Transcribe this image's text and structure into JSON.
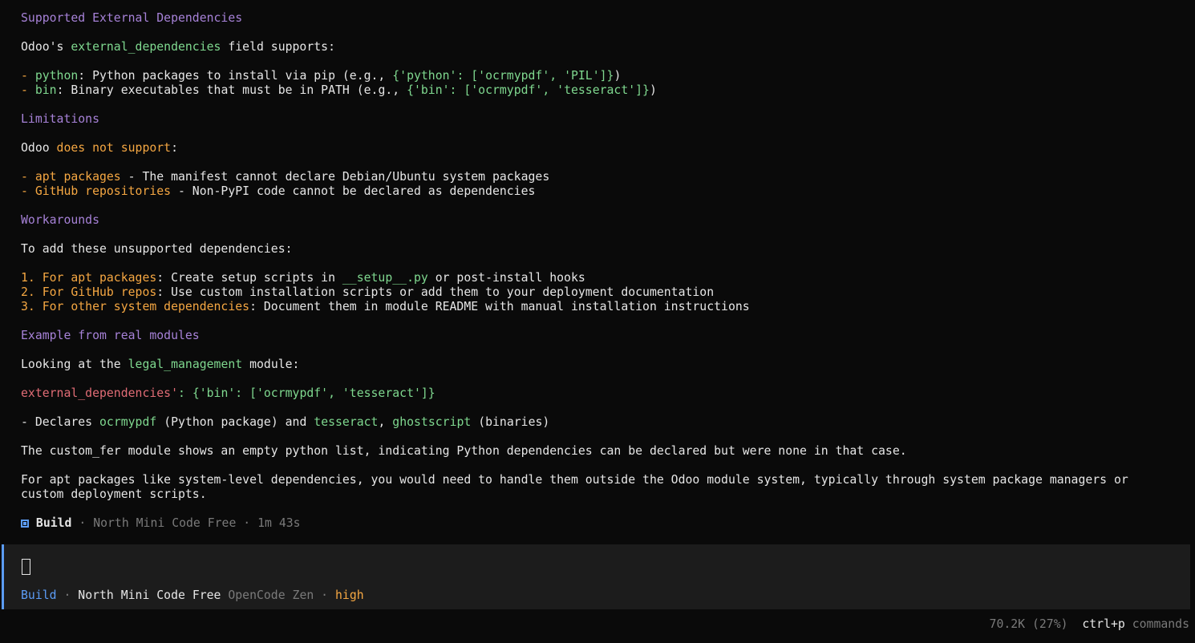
{
  "content": {
    "h_supported": "Supported External Dependencies",
    "intro": {
      "prefix": "Odoo's ",
      "field": "external_dependencies",
      "suffix": " field supports:"
    },
    "python_item": {
      "dash": "- ",
      "key": "python",
      "text": ": Python packages to install via pip (e.g., ",
      "example": "{'python': ['ocrmypdf', 'PIL']}",
      "close": ")"
    },
    "bin_item": {
      "dash": "- ",
      "key": "bin",
      "text": ": Binary executables that must be in PATH (e.g., ",
      "example": "{'bin': ['ocrmypdf', 'tesseract']}",
      "close": ")"
    },
    "h_limitations": "Limitations",
    "limit_intro": {
      "prefix": "Odoo ",
      "emph": "does not support",
      "suffix": ":"
    },
    "limit_apt": {
      "lead": "- apt packages",
      "text": " - The manifest cannot declare Debian/Ubuntu system packages"
    },
    "limit_github": {
      "lead": "- GitHub repositories",
      "text": " - Non-PyPI code cannot be declared as dependencies"
    },
    "h_workarounds": "Workarounds",
    "work_intro": "To add these unsupported dependencies:",
    "work_1": {
      "lead": "1. For apt packages",
      "text": ": Create setup scripts in ",
      "code": "__setup__.py",
      "tail": " or post-install hooks"
    },
    "work_2": {
      "lead": "2. For GitHub repos",
      "text": ": Use custom installation scripts or add them to your deployment documentation"
    },
    "work_3": {
      "lead": "3. For other system dependencies",
      "text": ": Document them in module README with manual installation instructions"
    },
    "h_example": "Example from real modules",
    "example_intro": {
      "prefix": "Looking at the ",
      "module": "legal_management",
      "suffix": " module:"
    },
    "example_code": {
      "key": "external_dependencies'",
      "value": ": {'bin': ['ocrmypdf', 'tesseract']}"
    },
    "declares": {
      "prefix": "- Declares ",
      "p1": "ocrmypdf",
      "mid": " (Python package) and ",
      "p2": "tesseract",
      "comma": ", ",
      "p3": "ghostscript",
      "suffix": " (binaries)"
    },
    "custom_fer": "The custom_fer module shows an empty python list, indicating Python dependencies can be declared but were none in that case.",
    "apt_note_1": "For apt packages like system-level dependencies, you would need to handle them outside the Odoo module system, typically through system package managers or",
    "apt_note_2": "custom deployment scripts."
  },
  "status": {
    "label": "Build",
    "sep1": " · ",
    "model": "North Mini Code Free",
    "sep2": " · ",
    "time": "1m 43s"
  },
  "input_panel": {
    "mode": "Build",
    "sep1": " · ",
    "model": "North Mini Code Free",
    "provider": " OpenCode Zen",
    "sep2": " · ",
    "effort": "high"
  },
  "footer": {
    "tokens": "70.2K (27%)",
    "shortcut": "ctrl+p",
    "commands": " commands"
  },
  "colors": {
    "heading": "#a782d8",
    "code": "#7fd88f",
    "emphasis": "#f5a742",
    "key": "#e06c75",
    "accent": "#5c9cf5",
    "panel_bg": "#1c1c1c",
    "bg": "#0a0a0a"
  },
  "icons": {
    "build": "square-icon"
  }
}
